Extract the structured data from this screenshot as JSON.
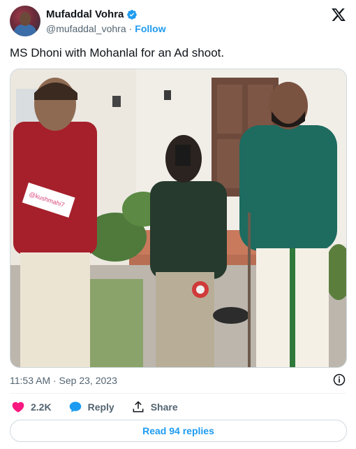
{
  "author": {
    "name": "Mufaddal Vohra",
    "handle": "@mufaddal_vohra",
    "separator": "·",
    "follow_label": "Follow",
    "verified_color": "#1d9bf0"
  },
  "tweet": {
    "text": "MS Dhoni with Mohanlal for an Ad shoot.",
    "timestamp": "11:53 AM · Sep 23, 2023",
    "photo_paper_text": "@kushmahi7"
  },
  "actions": {
    "likes": "2.2K",
    "reply_label": "Reply",
    "share_label": "Share"
  },
  "replies_button": "Read 94 replies",
  "icons": {
    "brand": "x-logo-icon",
    "verified": "verified-badge-icon",
    "info": "info-icon",
    "like": "heart-icon",
    "reply": "reply-bubble-icon",
    "share": "share-icon"
  },
  "colors": {
    "accent": "#1d9bf0",
    "like": "#f91880",
    "muted": "#536471"
  }
}
